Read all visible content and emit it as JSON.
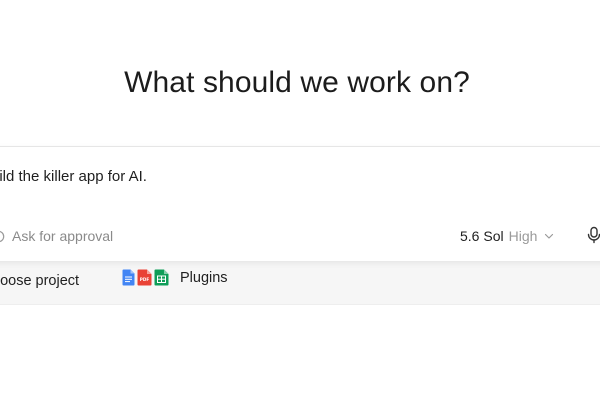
{
  "main": {
    "headline": "What should we work on?"
  },
  "composer": {
    "prompt_text": "uild the killer app for AI.",
    "approval_label": "Ask for approval",
    "model": {
      "name": "5.6 Sol",
      "effort": "High"
    }
  },
  "footer": {
    "choose_project_label": "hoose project",
    "plugins_label": "Plugins",
    "plugin_icons": [
      "google-docs-icon",
      "pdf-icon",
      "google-sheets-icon"
    ]
  },
  "colors": {
    "docs_blue": "#4285f4",
    "pdf_red": "#e94235",
    "sheets_green": "#0f9d58",
    "muted_text": "#8a8a8a"
  }
}
